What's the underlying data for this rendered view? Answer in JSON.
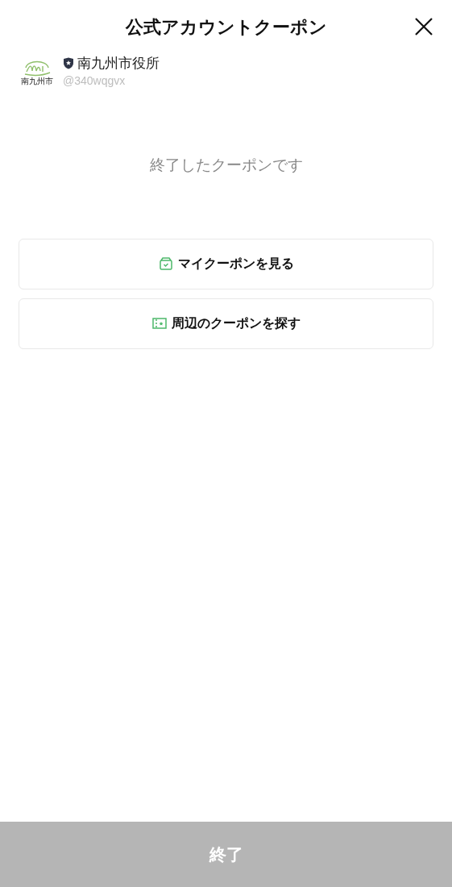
{
  "header": {
    "title": "公式アカウントクーポン"
  },
  "account": {
    "logo_text": "南九州市",
    "name": "南九州市役所",
    "id": "@340wqgvx"
  },
  "message": "終了したクーポンです",
  "buttons": [
    {
      "kind": "my",
      "label": "マイクーポンを見る"
    },
    {
      "kind": "nearby",
      "label": "周辺のクーポンを探す"
    }
  ],
  "footer": {
    "label": "終了",
    "disabled": true
  }
}
